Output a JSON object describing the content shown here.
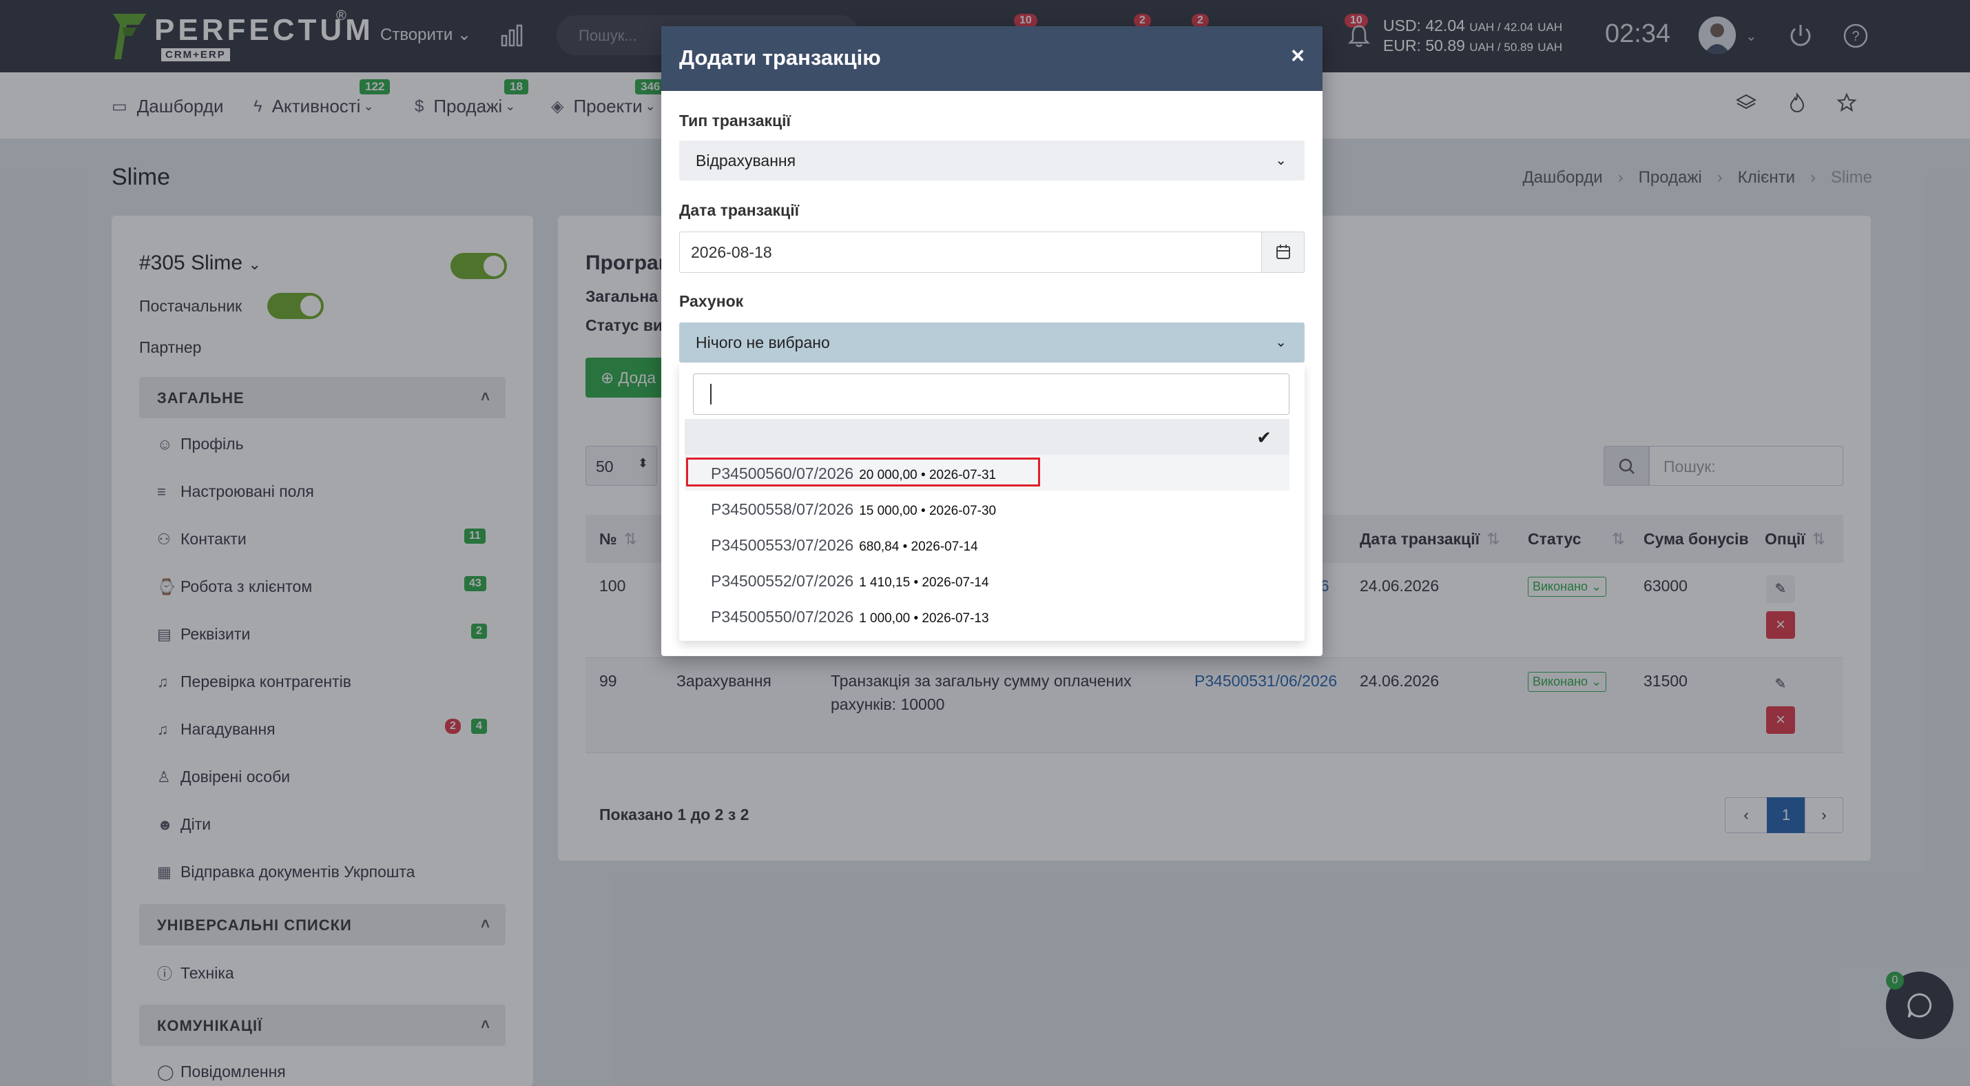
{
  "app": {
    "logo_text": "PERFECTUM",
    "logo_sub": "CRM+ERP",
    "logo_reg": "®"
  },
  "topbar": {
    "create_label": "Створити ⌄",
    "search_placeholder": "Пошук...",
    "badges": [
      "10",
      "2",
      "2",
      "10"
    ],
    "rates_usd": "USD: 42.04",
    "rates_usd_tail": "UAH / 42.04",
    "rates_usd_unit": "UAH",
    "rates_eur": "EUR: 50.89",
    "rates_eur_tail": "UAH / 50.89",
    "rates_eur_unit": "UAH",
    "clock": "02:34"
  },
  "nav": {
    "items": [
      {
        "label": "Дашборди",
        "icon": "monitor-icon"
      },
      {
        "label": "Активності",
        "badge": "122",
        "icon": "bolt-icon"
      },
      {
        "label": "Продажі",
        "badge": "18",
        "icon": "dollar-icon"
      },
      {
        "label": "Проекти",
        "badge": "346",
        "icon": "layers-icon"
      }
    ]
  },
  "page": {
    "title": "Slime",
    "breadcrumb": [
      "Дашборди",
      "Продажі",
      "Клієнти",
      "Slime"
    ]
  },
  "left": {
    "client_name": "#305 Slime",
    "supplier_label": "Постачальник",
    "partner_label": "Партнер",
    "sections": {
      "general": "ЗАГАЛЬНЕ",
      "universal": "УНІВЕРСАЛЬНІ СПИСКИ",
      "comm": "КОМУНІКАЦІЇ"
    },
    "items": [
      {
        "label": "Профіль",
        "icon": "user-icon"
      },
      {
        "label": "Настроювані поля",
        "icon": "list-icon"
      },
      {
        "label": "Контакти",
        "icon": "users-icon",
        "badge": "11"
      },
      {
        "label": "Робота з клієнтом",
        "icon": "watch-icon",
        "badge": "43"
      },
      {
        "label": "Реквізити",
        "icon": "id-card-icon",
        "badge": "2"
      },
      {
        "label": "Перевірка контрагентів",
        "icon": "bell-icon"
      },
      {
        "label": "Нагадування",
        "icon": "bell-icon",
        "badge_red": "2",
        "badge": "4"
      },
      {
        "label": "Довірені особи",
        "icon": "person-icon"
      },
      {
        "label": "Діти",
        "icon": "child-icon"
      },
      {
        "label": "Відправка документів Укрпошта",
        "icon": "boxes-icon"
      }
    ],
    "universal_items": [
      {
        "label": "Техніка",
        "icon": "info-icon"
      }
    ],
    "comm_items": [
      {
        "label": "Повідомлення",
        "icon": "chat-icon"
      }
    ]
  },
  "main": {
    "title": "Програм",
    "sub1": "Загальна",
    "sub2": "Статус ви",
    "add_label": "⊕ Дода",
    "per_page": "50",
    "search_placeholder": "Пошук:",
    "columns": [
      "№",
      "Дата транзакції",
      "Статус",
      "Сума бонусів",
      "Опції"
    ],
    "rows": [
      {
        "num": "100",
        "type": "",
        "desc": "",
        "invoice": "26",
        "date": "24.06.2026",
        "status": "Виконано",
        "bonus": "63000"
      },
      {
        "num": "99",
        "type": "Зарахування",
        "desc": "Транзакція за загальну сумму оплачених рахунків: 10000",
        "invoice": "P34500531/06/2026",
        "date": "24.06.2026",
        "status": "Виконано",
        "bonus": "31500"
      }
    ],
    "shown": "Показано 1 до 2 з 2",
    "page": "1"
  },
  "modal": {
    "title": "Додати транзакцію",
    "close": "×",
    "type_label": "Тип транзакції",
    "type_value": "Відрахування",
    "date_label": "Дата транзакції",
    "date_value": "2026-08-18",
    "account_label": "Рахунок",
    "account_value": "Нічого не вибрано",
    "options": [
      {
        "num": "P34500560/07/2026",
        "meta": "20 000,00 • 2026-07-31"
      },
      {
        "num": "P34500558/07/2026",
        "meta": "15 000,00 • 2026-07-30"
      },
      {
        "num": "P34500553/07/2026",
        "meta": "680,84 • 2026-07-14"
      },
      {
        "num": "P34500552/07/2026",
        "meta": "1 410,15 • 2026-07-14"
      },
      {
        "num": "P34500550/07/2026",
        "meta": "1 000,00 • 2026-07-13"
      }
    ]
  },
  "chat": {
    "badge": "0"
  },
  "colors": {
    "topbar": "#2d323d",
    "modal_header": "#3d4e68",
    "success": "#28a745",
    "danger": "#dc3545",
    "highlight": "#e0202a"
  }
}
